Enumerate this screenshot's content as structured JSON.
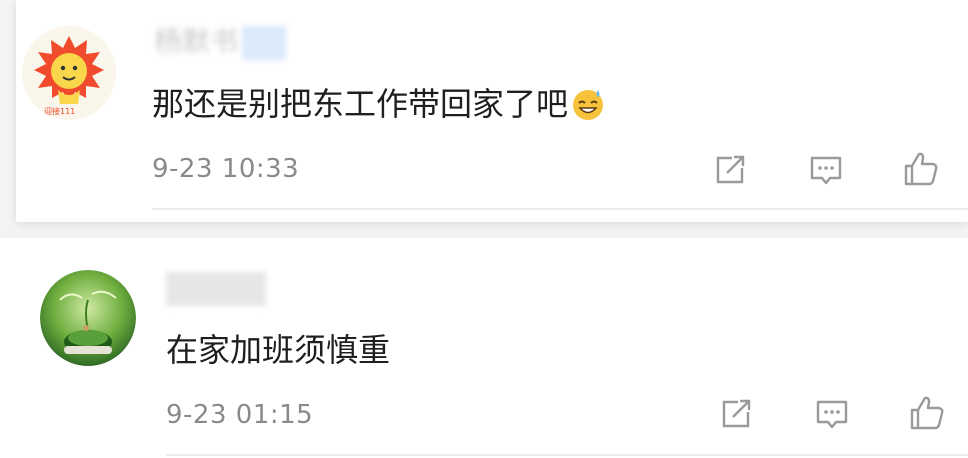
{
  "comments": [
    {
      "username": "杨默书",
      "avatar": "lion-avatar",
      "text": "那还是别把东工作带回家了吧",
      "emoji": "grin-sweat-emoji",
      "timestamp": "9-23 10:33",
      "icons": {
        "share": "share-icon",
        "comment": "comment-icon",
        "like": "thumbs-up-icon"
      }
    },
    {
      "username": "",
      "avatar": "plant-avatar",
      "text": "在家加班须慎重",
      "timestamp": "9-23 01:15",
      "icons": {
        "share": "share-icon",
        "comment": "comment-icon",
        "like": "thumbs-up-icon"
      }
    }
  ],
  "colors": {
    "text": "#1f1f1f",
    "meta": "#8a8a8a",
    "icon": "#9a9a9a",
    "divider": "#ececec"
  }
}
